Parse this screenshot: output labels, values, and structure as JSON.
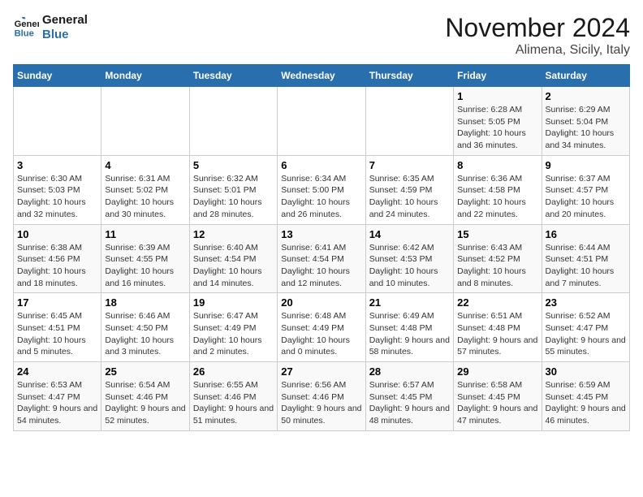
{
  "logo": {
    "line1": "General",
    "line2": "Blue"
  },
  "title": "November 2024",
  "subtitle": "Alimena, Sicily, Italy",
  "weekdays": [
    "Sunday",
    "Monday",
    "Tuesday",
    "Wednesday",
    "Thursday",
    "Friday",
    "Saturday"
  ],
  "weeks": [
    [
      {
        "day": "",
        "info": ""
      },
      {
        "day": "",
        "info": ""
      },
      {
        "day": "",
        "info": ""
      },
      {
        "day": "",
        "info": ""
      },
      {
        "day": "",
        "info": ""
      },
      {
        "day": "1",
        "info": "Sunrise: 6:28 AM\nSunset: 5:05 PM\nDaylight: 10 hours and 36 minutes."
      },
      {
        "day": "2",
        "info": "Sunrise: 6:29 AM\nSunset: 5:04 PM\nDaylight: 10 hours and 34 minutes."
      }
    ],
    [
      {
        "day": "3",
        "info": "Sunrise: 6:30 AM\nSunset: 5:03 PM\nDaylight: 10 hours and 32 minutes."
      },
      {
        "day": "4",
        "info": "Sunrise: 6:31 AM\nSunset: 5:02 PM\nDaylight: 10 hours and 30 minutes."
      },
      {
        "day": "5",
        "info": "Sunrise: 6:32 AM\nSunset: 5:01 PM\nDaylight: 10 hours and 28 minutes."
      },
      {
        "day": "6",
        "info": "Sunrise: 6:34 AM\nSunset: 5:00 PM\nDaylight: 10 hours and 26 minutes."
      },
      {
        "day": "7",
        "info": "Sunrise: 6:35 AM\nSunset: 4:59 PM\nDaylight: 10 hours and 24 minutes."
      },
      {
        "day": "8",
        "info": "Sunrise: 6:36 AM\nSunset: 4:58 PM\nDaylight: 10 hours and 22 minutes."
      },
      {
        "day": "9",
        "info": "Sunrise: 6:37 AM\nSunset: 4:57 PM\nDaylight: 10 hours and 20 minutes."
      }
    ],
    [
      {
        "day": "10",
        "info": "Sunrise: 6:38 AM\nSunset: 4:56 PM\nDaylight: 10 hours and 18 minutes."
      },
      {
        "day": "11",
        "info": "Sunrise: 6:39 AM\nSunset: 4:55 PM\nDaylight: 10 hours and 16 minutes."
      },
      {
        "day": "12",
        "info": "Sunrise: 6:40 AM\nSunset: 4:54 PM\nDaylight: 10 hours and 14 minutes."
      },
      {
        "day": "13",
        "info": "Sunrise: 6:41 AM\nSunset: 4:54 PM\nDaylight: 10 hours and 12 minutes."
      },
      {
        "day": "14",
        "info": "Sunrise: 6:42 AM\nSunset: 4:53 PM\nDaylight: 10 hours and 10 minutes."
      },
      {
        "day": "15",
        "info": "Sunrise: 6:43 AM\nSunset: 4:52 PM\nDaylight: 10 hours and 8 minutes."
      },
      {
        "day": "16",
        "info": "Sunrise: 6:44 AM\nSunset: 4:51 PM\nDaylight: 10 hours and 7 minutes."
      }
    ],
    [
      {
        "day": "17",
        "info": "Sunrise: 6:45 AM\nSunset: 4:51 PM\nDaylight: 10 hours and 5 minutes."
      },
      {
        "day": "18",
        "info": "Sunrise: 6:46 AM\nSunset: 4:50 PM\nDaylight: 10 hours and 3 minutes."
      },
      {
        "day": "19",
        "info": "Sunrise: 6:47 AM\nSunset: 4:49 PM\nDaylight: 10 hours and 2 minutes."
      },
      {
        "day": "20",
        "info": "Sunrise: 6:48 AM\nSunset: 4:49 PM\nDaylight: 10 hours and 0 minutes."
      },
      {
        "day": "21",
        "info": "Sunrise: 6:49 AM\nSunset: 4:48 PM\nDaylight: 9 hours and 58 minutes."
      },
      {
        "day": "22",
        "info": "Sunrise: 6:51 AM\nSunset: 4:48 PM\nDaylight: 9 hours and 57 minutes."
      },
      {
        "day": "23",
        "info": "Sunrise: 6:52 AM\nSunset: 4:47 PM\nDaylight: 9 hours and 55 minutes."
      }
    ],
    [
      {
        "day": "24",
        "info": "Sunrise: 6:53 AM\nSunset: 4:47 PM\nDaylight: 9 hours and 54 minutes."
      },
      {
        "day": "25",
        "info": "Sunrise: 6:54 AM\nSunset: 4:46 PM\nDaylight: 9 hours and 52 minutes."
      },
      {
        "day": "26",
        "info": "Sunrise: 6:55 AM\nSunset: 4:46 PM\nDaylight: 9 hours and 51 minutes."
      },
      {
        "day": "27",
        "info": "Sunrise: 6:56 AM\nSunset: 4:46 PM\nDaylight: 9 hours and 50 minutes."
      },
      {
        "day": "28",
        "info": "Sunrise: 6:57 AM\nSunset: 4:45 PM\nDaylight: 9 hours and 48 minutes."
      },
      {
        "day": "29",
        "info": "Sunrise: 6:58 AM\nSunset: 4:45 PM\nDaylight: 9 hours and 47 minutes."
      },
      {
        "day": "30",
        "info": "Sunrise: 6:59 AM\nSunset: 4:45 PM\nDaylight: 9 hours and 46 minutes."
      }
    ]
  ]
}
